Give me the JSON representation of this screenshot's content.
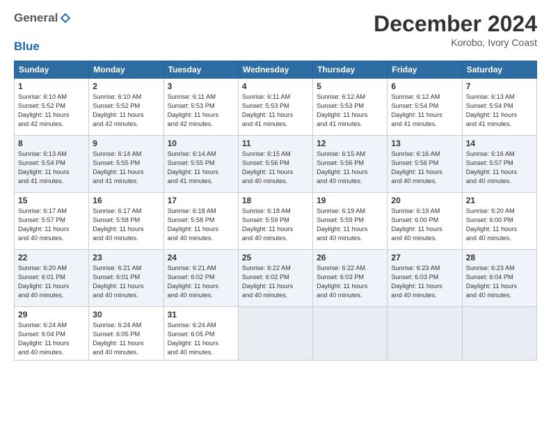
{
  "header": {
    "logo_general": "General",
    "logo_blue": "Blue",
    "month_title": "December 2024",
    "location": "Korobo, Ivory Coast"
  },
  "days": [
    "Sunday",
    "Monday",
    "Tuesday",
    "Wednesday",
    "Thursday",
    "Friday",
    "Saturday"
  ],
  "weeks": [
    [
      {
        "num": "1",
        "lines": [
          "Sunrise: 6:10 AM",
          "Sunset: 5:52 PM",
          "Daylight: 11 hours",
          "and 42 minutes."
        ]
      },
      {
        "num": "2",
        "lines": [
          "Sunrise: 6:10 AM",
          "Sunset: 5:52 PM",
          "Daylight: 11 hours",
          "and 42 minutes."
        ]
      },
      {
        "num": "3",
        "lines": [
          "Sunrise: 6:11 AM",
          "Sunset: 5:53 PM",
          "Daylight: 11 hours",
          "and 42 minutes."
        ]
      },
      {
        "num": "4",
        "lines": [
          "Sunrise: 6:11 AM",
          "Sunset: 5:53 PM",
          "Daylight: 11 hours",
          "and 41 minutes."
        ]
      },
      {
        "num": "5",
        "lines": [
          "Sunrise: 6:12 AM",
          "Sunset: 5:53 PM",
          "Daylight: 11 hours",
          "and 41 minutes."
        ]
      },
      {
        "num": "6",
        "lines": [
          "Sunrise: 6:12 AM",
          "Sunset: 5:54 PM",
          "Daylight: 11 hours",
          "and 41 minutes."
        ]
      },
      {
        "num": "7",
        "lines": [
          "Sunrise: 6:13 AM",
          "Sunset: 5:54 PM",
          "Daylight: 11 hours",
          "and 41 minutes."
        ]
      }
    ],
    [
      {
        "num": "8",
        "lines": [
          "Sunrise: 6:13 AM",
          "Sunset: 5:54 PM",
          "Daylight: 11 hours",
          "and 41 minutes."
        ]
      },
      {
        "num": "9",
        "lines": [
          "Sunrise: 6:14 AM",
          "Sunset: 5:55 PM",
          "Daylight: 11 hours",
          "and 41 minutes."
        ]
      },
      {
        "num": "10",
        "lines": [
          "Sunrise: 6:14 AM",
          "Sunset: 5:55 PM",
          "Daylight: 11 hours",
          "and 41 minutes."
        ]
      },
      {
        "num": "11",
        "lines": [
          "Sunrise: 6:15 AM",
          "Sunset: 5:56 PM",
          "Daylight: 11 hours",
          "and 40 minutes."
        ]
      },
      {
        "num": "12",
        "lines": [
          "Sunrise: 6:15 AM",
          "Sunset: 5:56 PM",
          "Daylight: 11 hours",
          "and 40 minutes."
        ]
      },
      {
        "num": "13",
        "lines": [
          "Sunrise: 6:16 AM",
          "Sunset: 5:56 PM",
          "Daylight: 11 hours",
          "and 40 minutes."
        ]
      },
      {
        "num": "14",
        "lines": [
          "Sunrise: 6:16 AM",
          "Sunset: 5:57 PM",
          "Daylight: 11 hours",
          "and 40 minutes."
        ]
      }
    ],
    [
      {
        "num": "15",
        "lines": [
          "Sunrise: 6:17 AM",
          "Sunset: 5:57 PM",
          "Daylight: 11 hours",
          "and 40 minutes."
        ]
      },
      {
        "num": "16",
        "lines": [
          "Sunrise: 6:17 AM",
          "Sunset: 5:58 PM",
          "Daylight: 11 hours",
          "and 40 minutes."
        ]
      },
      {
        "num": "17",
        "lines": [
          "Sunrise: 6:18 AM",
          "Sunset: 5:58 PM",
          "Daylight: 11 hours",
          "and 40 minutes."
        ]
      },
      {
        "num": "18",
        "lines": [
          "Sunrise: 6:18 AM",
          "Sunset: 5:59 PM",
          "Daylight: 11 hours",
          "and 40 minutes."
        ]
      },
      {
        "num": "19",
        "lines": [
          "Sunrise: 6:19 AM",
          "Sunset: 5:59 PM",
          "Daylight: 11 hours",
          "and 40 minutes."
        ]
      },
      {
        "num": "20",
        "lines": [
          "Sunrise: 6:19 AM",
          "Sunset: 6:00 PM",
          "Daylight: 11 hours",
          "and 40 minutes."
        ]
      },
      {
        "num": "21",
        "lines": [
          "Sunrise: 6:20 AM",
          "Sunset: 6:00 PM",
          "Daylight: 11 hours",
          "and 40 minutes."
        ]
      }
    ],
    [
      {
        "num": "22",
        "lines": [
          "Sunrise: 6:20 AM",
          "Sunset: 6:01 PM",
          "Daylight: 11 hours",
          "and 40 minutes."
        ]
      },
      {
        "num": "23",
        "lines": [
          "Sunrise: 6:21 AM",
          "Sunset: 6:01 PM",
          "Daylight: 11 hours",
          "and 40 minutes."
        ]
      },
      {
        "num": "24",
        "lines": [
          "Sunrise: 6:21 AM",
          "Sunset: 6:02 PM",
          "Daylight: 11 hours",
          "and 40 minutes."
        ]
      },
      {
        "num": "25",
        "lines": [
          "Sunrise: 6:22 AM",
          "Sunset: 6:02 PM",
          "Daylight: 11 hours",
          "and 40 minutes."
        ]
      },
      {
        "num": "26",
        "lines": [
          "Sunrise: 6:22 AM",
          "Sunset: 6:03 PM",
          "Daylight: 11 hours",
          "and 40 minutes."
        ]
      },
      {
        "num": "27",
        "lines": [
          "Sunrise: 6:23 AM",
          "Sunset: 6:03 PM",
          "Daylight: 11 hours",
          "and 40 minutes."
        ]
      },
      {
        "num": "28",
        "lines": [
          "Sunrise: 6:23 AM",
          "Sunset: 6:04 PM",
          "Daylight: 11 hours",
          "and 40 minutes."
        ]
      }
    ],
    [
      {
        "num": "29",
        "lines": [
          "Sunrise: 6:24 AM",
          "Sunset: 6:04 PM",
          "Daylight: 11 hours",
          "and 40 minutes."
        ]
      },
      {
        "num": "30",
        "lines": [
          "Sunrise: 6:24 AM",
          "Sunset: 6:05 PM",
          "Daylight: 11 hours",
          "and 40 minutes."
        ]
      },
      {
        "num": "31",
        "lines": [
          "Sunrise: 6:24 AM",
          "Sunset: 6:05 PM",
          "Daylight: 11 hours",
          "and 40 minutes."
        ]
      },
      null,
      null,
      null,
      null
    ]
  ]
}
